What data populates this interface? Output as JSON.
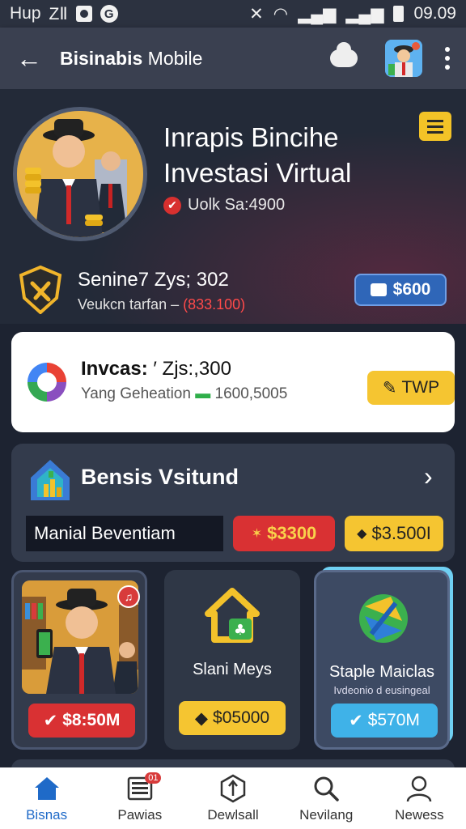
{
  "status_bar": {
    "carrier": "Hup",
    "carrier_icon": "ZⅡ",
    "time": "09.09"
  },
  "app_bar": {
    "title_bold": "Bisinabis",
    "title_rest": "Mobile"
  },
  "hero": {
    "title_line1": "Inrapis Bincihe",
    "title_line2": "Investasi Virtual",
    "subtitle": "Uolk Sa:4900",
    "stat_label": "Senine7 Zys; 302",
    "stat_sub": "Veukcn tarfan",
    "stat_sub_value": "(833.100)",
    "pill_value": "$600"
  },
  "invest_card": {
    "title_bold": "Invcas:",
    "title_rest": "′ Zjs:,300",
    "sub": "Yang Geheation",
    "sub_value": "1600,5005",
    "button_label": "TWP"
  },
  "bensis": {
    "title": "Bensis Vsitund",
    "field_value": "Manial Beventiam",
    "red_button": "$3300",
    "yellow_button": "$3.500I"
  },
  "tiles": [
    {
      "button": "$8:50M"
    },
    {
      "label": "Slani Meys",
      "button": "$05000"
    },
    {
      "label": "Staple Maiclas",
      "sub": "Ivdeonio d eusingeal",
      "button": "$570M"
    }
  ],
  "bottom_nav": [
    {
      "label": "Bisnas",
      "active": true
    },
    {
      "label": "Pawias",
      "badge": "01"
    },
    {
      "label": "Dewlsall"
    },
    {
      "label": "Nevilang"
    },
    {
      "label": "Newess"
    }
  ],
  "colors": {
    "accent_yellow": "#f5c531",
    "accent_red": "#d93133",
    "accent_blue": "#1f6ac8",
    "card_bg": "#333b4c"
  }
}
